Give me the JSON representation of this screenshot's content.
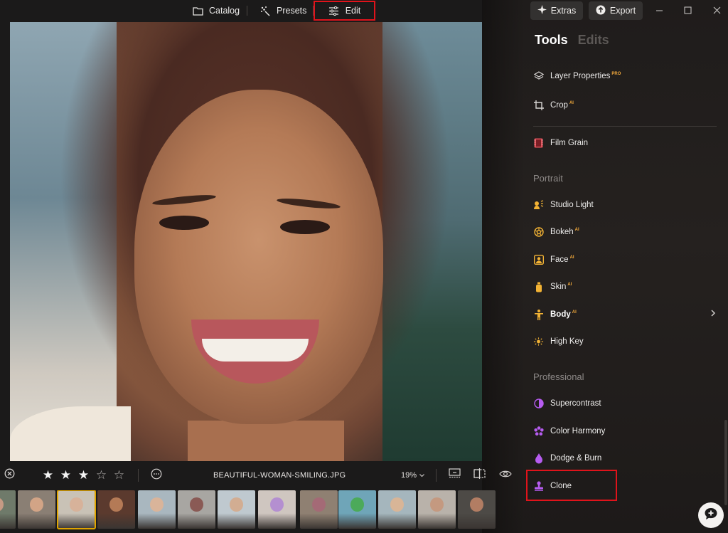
{
  "topbar": {
    "tabs": [
      {
        "label": "Catalog",
        "icon": "folder-icon"
      },
      {
        "label": "Presets",
        "icon": "sparkle-wand-icon"
      },
      {
        "label": "Edit",
        "icon": "sliders-icon"
      }
    ],
    "extras_label": "Extras",
    "export_label": "Export"
  },
  "panel": {
    "tabs": [
      "Tools",
      "Edits"
    ],
    "tools_top": [
      {
        "label": "Layer Properties",
        "tag": "PRO",
        "icon": "layers-icon",
        "color": "#d8d5d3"
      },
      {
        "label": "Crop",
        "tag": "AI",
        "icon": "crop-icon",
        "color": "#d8d5d3"
      },
      {
        "label": "Film Grain",
        "tag": "",
        "icon": "film-icon",
        "color": "#e0525a"
      }
    ],
    "portrait_heading": "Portrait",
    "portrait": [
      {
        "label": "Studio Light",
        "tag": "",
        "icon": "studio-light-icon",
        "color": "#f2b234"
      },
      {
        "label": "Bokeh",
        "tag": "AI",
        "icon": "bokeh-icon",
        "color": "#f2b234"
      },
      {
        "label": "Face",
        "tag": "AI",
        "icon": "face-icon",
        "color": "#f2b234"
      },
      {
        "label": "Skin",
        "tag": "AI",
        "icon": "skin-icon",
        "color": "#f2b234"
      },
      {
        "label": "Body",
        "tag": "AI",
        "icon": "body-icon",
        "color": "#f2b234"
      },
      {
        "label": "High Key",
        "tag": "",
        "icon": "high-key-icon",
        "color": "#f2b234"
      }
    ],
    "professional_heading": "Professional",
    "professional": [
      {
        "label": "Supercontrast",
        "tag": "",
        "icon": "supercontrast-icon",
        "color": "#b65cf0"
      },
      {
        "label": "Color Harmony",
        "tag": "",
        "icon": "color-harmony-icon",
        "color": "#b65cf0"
      },
      {
        "label": "Dodge & Burn",
        "tag": "",
        "icon": "dodge-burn-icon",
        "color": "#b65cf0"
      },
      {
        "label": "Clone",
        "tag": "",
        "icon": "clone-stamp-icon",
        "color": "#b65cf0"
      }
    ]
  },
  "infobar": {
    "rating": 3,
    "max_rating": 5,
    "filename": "BEAUTIFUL-WOMAN-SMILING.JPG",
    "zoom": "19%"
  },
  "filmstrip": {
    "count": 13,
    "active_index": 2
  },
  "colors": {
    "highlight_red": "#e0131b",
    "active_thumb": "#e0a400",
    "pro_tag": "#f2a93b"
  }
}
